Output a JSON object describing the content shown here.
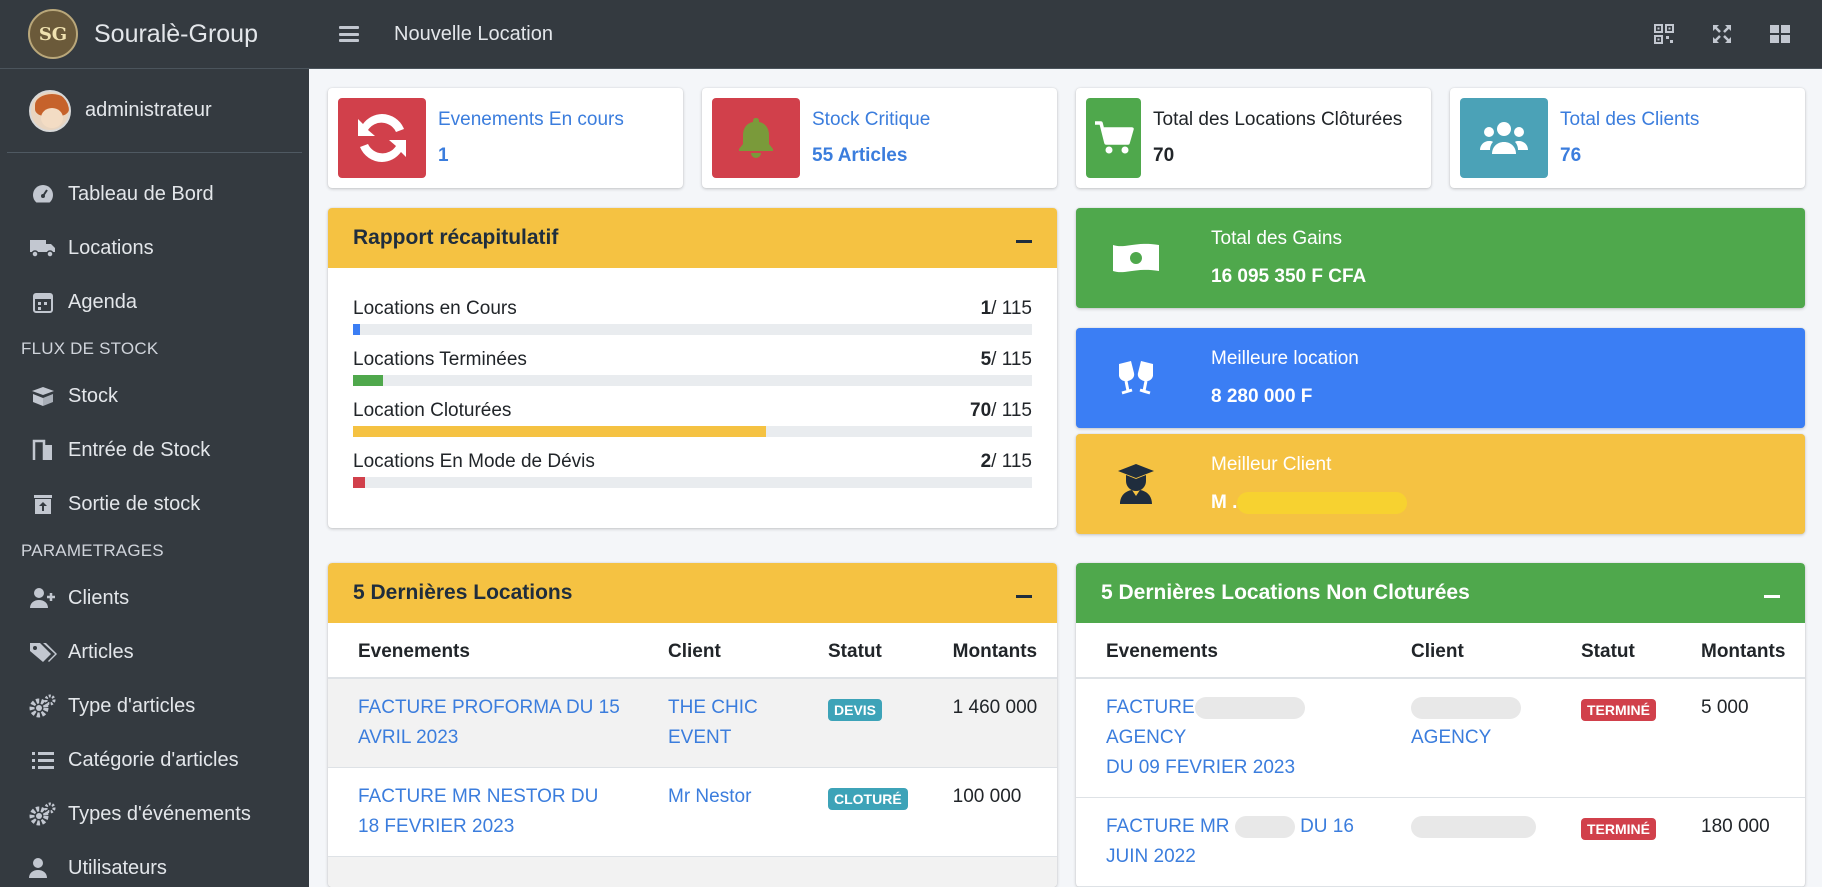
{
  "brand": {
    "logo_text": "SG",
    "name": "Souralè-Group"
  },
  "user": {
    "name": "administrateur"
  },
  "nav": {
    "items_main": [
      {
        "label": "Tableau de Bord",
        "icon": "tachometer-icon"
      },
      {
        "label": "Locations",
        "icon": "truck-icon"
      },
      {
        "label": "Agenda",
        "icon": "calendar-icon"
      }
    ],
    "header_stock": "FLUX DE STOCK",
    "items_stock": [
      {
        "label": "Stock",
        "icon": "box-open-icon"
      },
      {
        "label": "Entrée de Stock",
        "icon": "door-enter-icon"
      },
      {
        "label": "Sortie de stock",
        "icon": "box-upload-icon"
      }
    ],
    "header_params": "PARAMETRAGES",
    "items_params": [
      {
        "label": "Clients",
        "icon": "user-plus-icon"
      },
      {
        "label": "Articles",
        "icon": "tags-icon"
      },
      {
        "label": "Type d'articles",
        "icon": "cogs-icon"
      },
      {
        "label": "Catégorie d'articles",
        "icon": "list-icon"
      },
      {
        "label": "Types d'événements",
        "icon": "cogs-icon"
      },
      {
        "label": "Utilisateurs",
        "icon": "users-cog-icon"
      }
    ]
  },
  "topbar": {
    "title": "Nouvelle Location"
  },
  "info_boxes": [
    {
      "label": "Evenements En cours",
      "value": "1",
      "color": "#d1404b"
    },
    {
      "label": "Stock Critique",
      "value": "55 Articles",
      "color": "#d1404b"
    },
    {
      "label": "Total des Locations Clôturées",
      "value": "70",
      "color": "#4fa84c"
    },
    {
      "label": "Total des Clients",
      "value": "76",
      "color": "#4ba2b7"
    }
  ],
  "recap": {
    "title": "Rapport récapitulatif",
    "rows": [
      {
        "label": "Locations en Cours",
        "value": "1",
        "total": "/ 115",
        "fraction": 0.0087,
        "color": "#3b7ef4"
      },
      {
        "label": "Locations Terminées",
        "value": "5",
        "total": "/ 115",
        "fraction": 0.0435,
        "color": "#4fa84c"
      },
      {
        "label": "Location Cloturées",
        "value": "70",
        "total": "/ 115",
        "fraction": 0.6087,
        "color": "#f5c242"
      },
      {
        "label": "Locations En Mode de Dévis",
        "value": "2",
        "total": "/ 115",
        "fraction": 0.0174,
        "color": "#d1404b"
      }
    ]
  },
  "stats": {
    "gains": {
      "label": "Total des Gains",
      "value": "16 095 350 F CFA"
    },
    "best_location": {
      "label": "Meilleure location",
      "value": "8 280 000 F"
    },
    "best_client": {
      "label": "Meilleur Client",
      "value": "M ."
    }
  },
  "last_locations": {
    "title": "5 Dernières Locations",
    "headers": [
      "Evenements",
      "Client",
      "Statut",
      "Montants"
    ],
    "rows": [
      {
        "event": "FACTURE PROFORMA DU 15 AVRIL 2023",
        "client": "THE CHIC EVENT",
        "status": "DEVIS",
        "amount": "1 460 000"
      },
      {
        "event": "FACTURE MR NESTOR DU 18 FEVRIER 2023",
        "client": "Mr Nestor",
        "status": "CLOTURÉ",
        "amount": "100 000"
      }
    ]
  },
  "open_locations": {
    "title": "5 Dernières Locations Non Cloturées",
    "headers": [
      "Evenements",
      "Client",
      "Statut",
      "Montants"
    ],
    "rows": [
      {
        "event_a": "FACTURE",
        "event_b": "AGENCY",
        "event_c": "DU 09 FEVRIER 2023",
        "client": "AGENCY",
        "status": "TERMINÉ",
        "amount": "5 000"
      },
      {
        "event_a": "FACTURE MR",
        "event_b": "DU 16",
        "event_c": "JUIN 2022",
        "client": "",
        "status": "TERMINÉ",
        "amount": "180 000"
      }
    ]
  }
}
